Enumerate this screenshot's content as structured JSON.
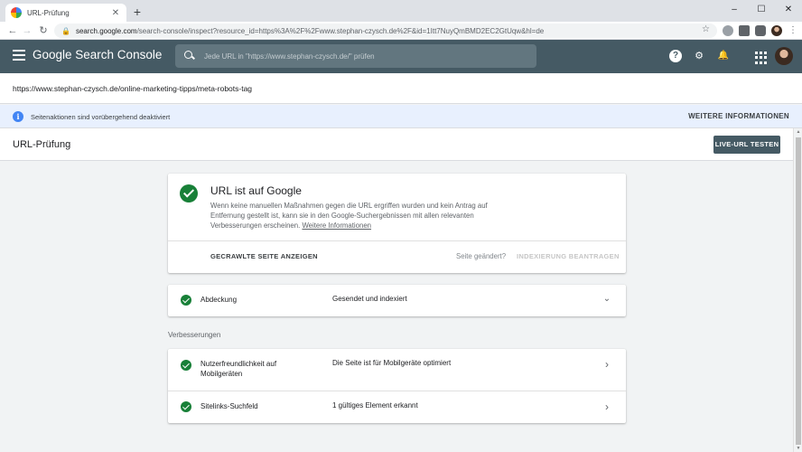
{
  "browser": {
    "tab_title": "URL-Prüfung",
    "tab_close": "✕",
    "new_tab": "+",
    "window_controls": [
      "–",
      "☐",
      "✕"
    ],
    "nav": {
      "back": "←",
      "forward": "→",
      "reload": "↻"
    },
    "url_host": "search.google.com",
    "url_rest": "/search-console/inspect?resource_id=https%3A%2F%2Fwww.stephan-czysch.de%2F&id=1Itt7NuyQmBMD2EC2GtUqw&hl=de",
    "bookmark_icon": "☆"
  },
  "header": {
    "brand": "Google Search Console",
    "search_placeholder": "Jede URL in \"https://www.stephan-czysch.de/\" prüfen",
    "help_icon": "?",
    "bell_icon": "🔔",
    "users_icon": "⚙"
  },
  "inspected_url": "https://www.stephan-czysch.de/online-marketing-tipps/meta-robots-tag",
  "banner": {
    "text": "Seitenaktionen sind vorübergehend deaktiviert",
    "link": "WEITERE INFORMATIONEN"
  },
  "page": {
    "title": "URL-Prüfung",
    "live_test_button": "LIVE-URL TESTEN"
  },
  "status": {
    "title": "URL ist auf Google",
    "description": "Wenn keine manuellen Maßnahmen gegen die URL ergriffen wurden und kein Antrag auf Entfernung gestellt ist, kann sie in den Google-Suchergebnissen mit allen relevanten Verbesserungen erscheinen.",
    "link": "Weitere Informationen",
    "crawled_button": "GECRAWLTE SEITE ANZEIGEN",
    "changed_text": "Seite geändert?",
    "index_button": "INDEXIERUNG BEANTRAGEN"
  },
  "coverage": {
    "label": "Abdeckung",
    "value": "Gesendet und indexiert",
    "chevron": "⌄"
  },
  "enhancements": {
    "section_label": "Verbesserungen",
    "items": [
      {
        "label": "Nutzerfreundlichkeit auf Mobilgeräten",
        "value": "Die Seite ist für Mobilgeräte optimiert",
        "chevron": "›"
      },
      {
        "label": "Sitelinks-Suchfeld",
        "value": "1 gültiges Element erkannt",
        "chevron": "›"
      }
    ]
  },
  "colors": {
    "header_bg": "#455a64",
    "success_green": "#188038",
    "banner_bg": "#e8f0fe",
    "info_blue": "#4285f4"
  }
}
